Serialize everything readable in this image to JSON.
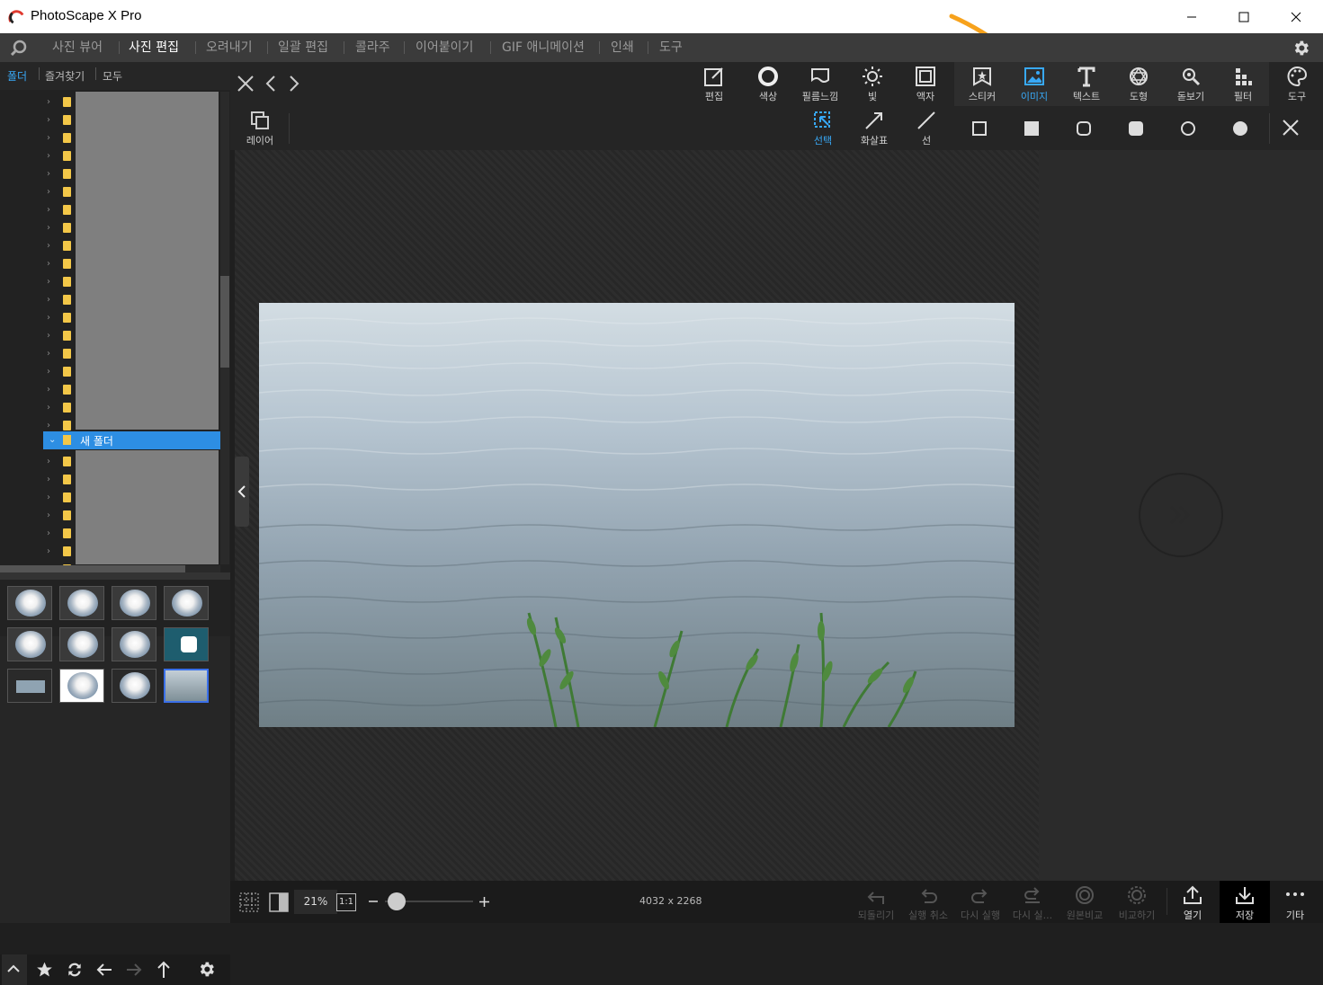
{
  "window": {
    "title": "PhotoScape X Pro"
  },
  "menu": {
    "items": [
      "사진 뷰어",
      "사진 편집",
      "오려내기",
      "일괄 편집",
      "콜라주",
      "이어붙이기",
      "GIF 애니메이션",
      "인쇄",
      "도구"
    ],
    "active": "사진 편집"
  },
  "sidebar": {
    "tabs": [
      "폴더",
      "즐겨찾기",
      "모두"
    ],
    "selected_folder": "새 폴더"
  },
  "toolbar": {
    "tools": [
      "편집",
      "색상",
      "필름느낌",
      "빛",
      "액자",
      "스티커",
      "이미지",
      "텍스트",
      "도형",
      "돋보기",
      "필터",
      "도구"
    ],
    "active": "이미지"
  },
  "subtoolbar": {
    "layer_label": "레이어",
    "modes": [
      "선택",
      "화살표",
      "선"
    ],
    "active_mode": "선택"
  },
  "status": {
    "zoom": "21%",
    "one_to_one": "1:1",
    "dimensions": "4032 x 2268",
    "actions": [
      "되돌리기",
      "실행 취소",
      "다시 실행",
      "다시 실...",
      "원본비교",
      "비교하기",
      "열기",
      "저장",
      "기타"
    ]
  },
  "colors": {
    "accent": "#38a9f7",
    "selection": "#2d8ee3",
    "arrow": "#f7a21c",
    "folder": "#f3c748"
  }
}
